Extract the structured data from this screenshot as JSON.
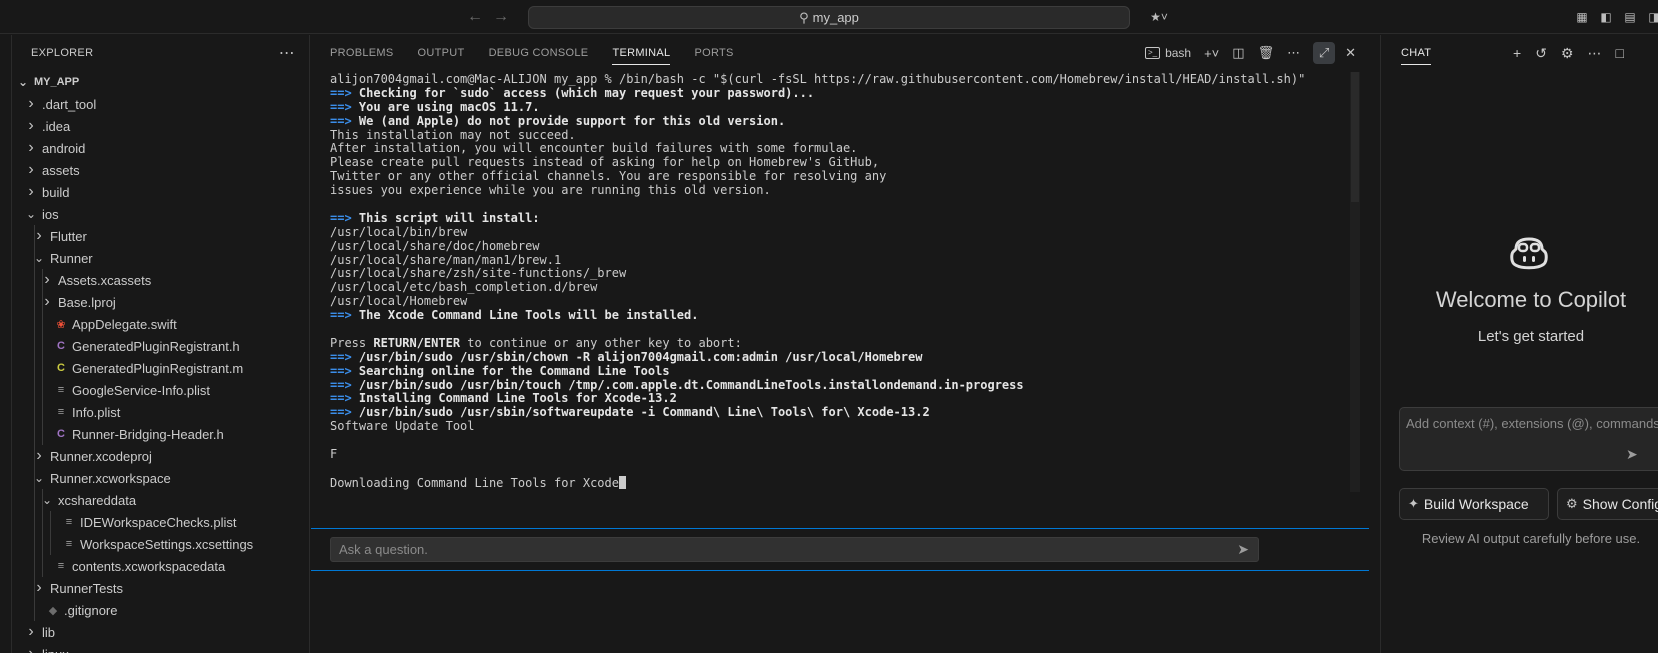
{
  "titlebar": {
    "search_text": "my_app"
  },
  "explorer": {
    "title": "EXPLORER",
    "items": [
      {
        "label": "MY_APP",
        "depth": 0,
        "chevron": "down",
        "icon": "none"
      },
      {
        "label": ".dart_tool",
        "depth": 1,
        "chevron": "right",
        "icon": "none"
      },
      {
        "label": ".idea",
        "depth": 1,
        "chevron": "right",
        "icon": "none"
      },
      {
        "label": "android",
        "depth": 1,
        "chevron": "right",
        "icon": "none"
      },
      {
        "label": "assets",
        "depth": 1,
        "chevron": "right",
        "icon": "none"
      },
      {
        "label": "build",
        "depth": 1,
        "chevron": "right",
        "icon": "none"
      },
      {
        "label": "ios",
        "depth": 1,
        "chevron": "down",
        "icon": "none"
      },
      {
        "label": "Flutter",
        "depth": 2,
        "chevron": "right",
        "icon": "none"
      },
      {
        "label": "Runner",
        "depth": 2,
        "chevron": "down",
        "icon": "none"
      },
      {
        "label": "Assets.xcassets",
        "depth": 3,
        "chevron": "right",
        "icon": "none"
      },
      {
        "label": "Base.lproj",
        "depth": 3,
        "chevron": "right",
        "icon": "none"
      },
      {
        "label": "AppDelegate.swift",
        "depth": 3,
        "chevron": "none",
        "icon": "swift"
      },
      {
        "label": "GeneratedPluginRegistrant.h",
        "depth": 3,
        "chevron": "none",
        "icon": "c-purple"
      },
      {
        "label": "GeneratedPluginRegistrant.m",
        "depth": 3,
        "chevron": "none",
        "icon": "c-yellow"
      },
      {
        "label": "GoogleService-Info.plist",
        "depth": 3,
        "chevron": "none",
        "icon": "lines"
      },
      {
        "label": "Info.plist",
        "depth": 3,
        "chevron": "none",
        "icon": "lines"
      },
      {
        "label": "Runner-Bridging-Header.h",
        "depth": 3,
        "chevron": "none",
        "icon": "c-purple"
      },
      {
        "label": "Runner.xcodeproj",
        "depth": 2,
        "chevron": "right",
        "icon": "none"
      },
      {
        "label": "Runner.xcworkspace",
        "depth": 2,
        "chevron": "down",
        "icon": "none"
      },
      {
        "label": "xcshareddata",
        "depth": 3,
        "chevron": "down",
        "icon": "none"
      },
      {
        "label": "IDEWorkspaceChecks.plist",
        "depth": 4,
        "chevron": "none",
        "icon": "lines"
      },
      {
        "label": "WorkspaceSettings.xcsettings",
        "depth": 4,
        "chevron": "none",
        "icon": "lines"
      },
      {
        "label": "contents.xcworkspacedata",
        "depth": 3,
        "chevron": "none",
        "icon": "lines"
      },
      {
        "label": "RunnerTests",
        "depth": 2,
        "chevron": "right",
        "icon": "none"
      },
      {
        "label": ".gitignore",
        "depth": 2,
        "chevron": "none",
        "icon": "git"
      },
      {
        "label": "lib",
        "depth": 1,
        "chevron": "right",
        "icon": "none"
      },
      {
        "label": "linux",
        "depth": 1,
        "chevron": "right",
        "icon": "none"
      }
    ]
  },
  "panel": {
    "tabs": [
      {
        "label": "PROBLEMS",
        "active": false
      },
      {
        "label": "OUTPUT",
        "active": false
      },
      {
        "label": "DEBUG CONSOLE",
        "active": false
      },
      {
        "label": "TERMINAL",
        "active": true
      },
      {
        "label": "PORTS",
        "active": false
      }
    ],
    "shell_label": "bash"
  },
  "terminal": {
    "lines": [
      {
        "arrow": false,
        "bold": false,
        "text": "alijon7004gmail.com@Mac-ALIJON my_app % /bin/bash -c \"$(curl -fsSL https://raw.githubusercontent.com/Homebrew/install/HEAD/install.sh)\""
      },
      {
        "arrow": true,
        "bold": true,
        "text": "Checking for `sudo` access (which may request your password)..."
      },
      {
        "arrow": true,
        "bold": true,
        "text": "You are using macOS 11.7."
      },
      {
        "arrow": true,
        "bold": true,
        "text": "We (and Apple) do not provide support for this old version."
      },
      {
        "arrow": false,
        "bold": false,
        "text": "This installation may not succeed."
      },
      {
        "arrow": false,
        "bold": false,
        "text": "After installation, you will encounter build failures with some formulae."
      },
      {
        "arrow": false,
        "bold": false,
        "text": "Please create pull requests instead of asking for help on Homebrew's GitHub,"
      },
      {
        "arrow": false,
        "bold": false,
        "text": "Twitter or any other official channels. You are responsible for resolving any"
      },
      {
        "arrow": false,
        "bold": false,
        "text": "issues you experience while you are running this old version."
      },
      {
        "arrow": false,
        "bold": false,
        "text": ""
      },
      {
        "arrow": true,
        "bold": true,
        "text": "This script will install:"
      },
      {
        "arrow": false,
        "bold": false,
        "text": "/usr/local/bin/brew"
      },
      {
        "arrow": false,
        "bold": false,
        "text": "/usr/local/share/doc/homebrew"
      },
      {
        "arrow": false,
        "bold": false,
        "text": "/usr/local/share/man/man1/brew.1"
      },
      {
        "arrow": false,
        "bold": false,
        "text": "/usr/local/share/zsh/site-functions/_brew"
      },
      {
        "arrow": false,
        "bold": false,
        "text": "/usr/local/etc/bash_completion.d/brew"
      },
      {
        "arrow": false,
        "bold": false,
        "text": "/usr/local/Homebrew"
      },
      {
        "arrow": true,
        "bold": true,
        "text": "The Xcode Command Line Tools will be installed."
      },
      {
        "arrow": false,
        "bold": false,
        "text": ""
      },
      {
        "arrow": false,
        "bold": false,
        "text": "Press ",
        "strong": "RETURN/ENTER",
        "rest": " to continue or any other key to abort:"
      },
      {
        "arrow": true,
        "bold": true,
        "text": "/usr/bin/sudo /usr/sbin/chown -R alijon7004gmail.com:admin /usr/local/Homebrew"
      },
      {
        "arrow": true,
        "bold": true,
        "text": "Searching online for the Command Line Tools"
      },
      {
        "arrow": true,
        "bold": true,
        "text": "/usr/bin/sudo /usr/bin/touch /tmp/.com.apple.dt.CommandLineTools.installondemand.in-progress"
      },
      {
        "arrow": true,
        "bold": true,
        "text": "Installing Command Line Tools for Xcode-13.2"
      },
      {
        "arrow": true,
        "bold": true,
        "text": "/usr/bin/sudo /usr/sbin/softwareupdate -i Command\\ Line\\ Tools\\ for\\ Xcode-13.2"
      },
      {
        "arrow": false,
        "bold": false,
        "text": "Software Update Tool"
      },
      {
        "arrow": false,
        "bold": false,
        "text": ""
      },
      {
        "arrow": false,
        "bold": false,
        "text": "F"
      },
      {
        "arrow": false,
        "bold": false,
        "text": ""
      },
      {
        "arrow": false,
        "bold": false,
        "text": "Downloading Command Line Tools for Xcode",
        "cursor": true
      }
    ],
    "arrow_glyph": "==>",
    "ask_placeholder": "Ask a question."
  },
  "chat": {
    "title": "CHAT",
    "welcome": "Welcome to Copilot",
    "subtitle": "Let's get started",
    "input_placeholder": "Add context (#), extensions (@), commands",
    "actions": [
      {
        "label": "Build Workspace",
        "icon": "wand-icon"
      },
      {
        "label": "Show Config",
        "icon": "gear-icon"
      }
    ],
    "review_note": "Review AI output carefully before use."
  },
  "colors": {
    "accent": "#0078d4",
    "arrow": "#3b8eea",
    "swift": "#f05138",
    "c_header": "#a074c4",
    "c_source": "#cbcb41"
  }
}
